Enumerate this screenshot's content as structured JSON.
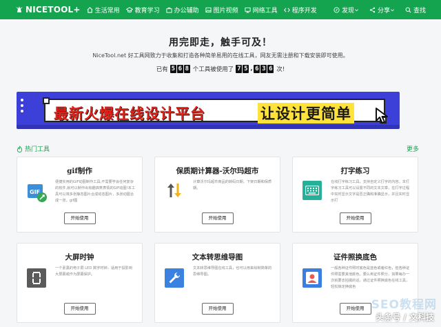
{
  "header": {
    "logo_text": "NICETOOL+",
    "nav": [
      {
        "label": "生活常用",
        "icon": "home-icon"
      },
      {
        "label": "教育学习",
        "icon": "graduation-cap-icon"
      },
      {
        "label": "办公辅助",
        "icon": "briefcase-icon"
      },
      {
        "label": "图片视频",
        "icon": "image-icon"
      },
      {
        "label": "网络工具",
        "icon": "network-icon"
      },
      {
        "label": "程序开发",
        "icon": "code-icon"
      }
    ],
    "right": [
      {
        "label": "发现",
        "icon": "discover-icon"
      },
      {
        "label": "分享",
        "icon": "share-icon"
      },
      {
        "label": "查找",
        "icon": "search-icon"
      }
    ]
  },
  "hero": {
    "title": "用完即走，触手可及！",
    "subtitle": "NiceTool.net 好工具网致力于收集和打造各种简单易用的在线工具，网友无需注册和下载安装即可使用。",
    "count_prefix": "已有",
    "tools_count": "568",
    "count_middle": "个工具被使用了",
    "use_count": "75,636",
    "count_suffix": "次!"
  },
  "banner": {
    "text_left": "最新火爆在线设计平台",
    "text_right": "让设计更简单"
  },
  "section": {
    "title": "热门工具",
    "more": "更多"
  },
  "cards": [
    {
      "title": "gif制作",
      "desc": "便捷实用的GIF动图制作工具,不需要学会任何复杂的软件,就可以制作出有趣搞笑表情的GIF动图!本工具可以将多张静态图片合成动态图片，多张动图合成一张，gif图",
      "button": "开始使用",
      "icon": "gif-icon",
      "color": "#3b8fd9"
    },
    {
      "title": "保质期计算器-沃尔玛超市",
      "desc": "计算沃尔玛超市商品的转码日期，下架日期和保质期。",
      "button": "开始使用",
      "icon": "up-down-arrows-icon",
      "color": "#ffffff"
    },
    {
      "title": "打字练习",
      "desc": "在线打字练习工具，支持自定义打字的内容。本打字练习工具可以设置不同的文本文章，在打字过程中实时显示文字是否正确和准确显示，并且实时显示打",
      "button": "开始使用",
      "icon": "keyboard-icon",
      "color": "#26b09a"
    },
    {
      "title": "大屏时钟",
      "desc": "一个素黑的电子屏 LED 数字时钟，适用于投影到大屏幕或作为屏幕保护。",
      "button": "开始使用",
      "icon": "led-digit-icon",
      "color": "#5a5a5a"
    },
    {
      "title": "文本转思维导图",
      "desc": "文本转思维导图在线工具，也可以用来绘制简单的思维导图。",
      "button": "开始使用",
      "icon": "wrench-icon",
      "color": "#3b82e0"
    },
    {
      "title": "证件照换底色",
      "desc": "一般各种证件照时底色是蓝色或者红色，但各种证件照需要其他颜色。要么到证件照分，如果每办一次就要去拍摄的话，通过证件照换底色在线工具，轻松搞定换底色",
      "button": "开始使用",
      "icon": "id-photo-icon",
      "color": "#3b7fe0"
    }
  ],
  "watermark": {
    "line1": "头条号 / 文科技",
    "line2": "SEO教程网"
  }
}
